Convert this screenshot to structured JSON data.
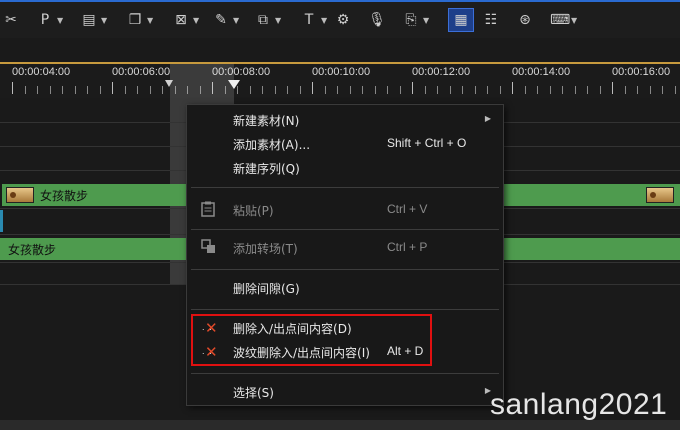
{
  "toolbar": {
    "items": [
      {
        "icon": "scissors-icon",
        "glyph": "✂",
        "caret": false
      },
      {
        "icon": "p-mode-icon",
        "glyph": "P",
        "caret": true
      },
      {
        "icon": "clipboard-icon",
        "glyph": "▤",
        "caret": true
      },
      {
        "icon": "copy-icon",
        "glyph": "❐",
        "caret": true
      },
      {
        "icon": "delete-icon",
        "glyph": "⊠",
        "caret": true
      },
      {
        "icon": "text-marker-icon",
        "glyph": "✎",
        "caret": true
      },
      {
        "icon": "crop-icon",
        "glyph": "⧉",
        "caret": true
      },
      {
        "icon": "title-icon",
        "glyph": "T",
        "caret": true
      },
      {
        "icon": "capture-icon",
        "glyph": "⚙",
        "caret": false
      },
      {
        "icon": "microphone-icon",
        "glyph": "🎙",
        "caret": false
      },
      {
        "icon": "video-effect-icon",
        "glyph": "⎘",
        "caret": true
      },
      {
        "icon": "grid-icon",
        "glyph": "▦",
        "caret": false,
        "active": true
      },
      {
        "icon": "mixer-icon",
        "glyph": "☷",
        "caret": false
      },
      {
        "icon": "reel-icon",
        "glyph": "⊛",
        "caret": false
      },
      {
        "icon": "keyboard-icon",
        "glyph": "⌨",
        "caret": true
      }
    ]
  },
  "ruler": {
    "labels": [
      "00:00:04:00",
      "00:00:06:00",
      "00:00:08:00",
      "00:00:10:00",
      "00:00:12:00",
      "00:00:14:00",
      "00:00:16:00"
    ]
  },
  "tracks": {
    "clip_video_left": "女孩散步",
    "clip_audio": "女孩散步"
  },
  "context_menu": {
    "new_material": "新建素材(N)",
    "add_material": "添加素材(A)...",
    "add_material_shortcut": "Shift + Ctrl + O",
    "new_sequence": "新建序列(Q)",
    "paste": "粘贴(P)",
    "paste_shortcut": "Ctrl + V",
    "add_transition": "添加转场(T)",
    "add_transition_shortcut": "Ctrl + P",
    "delete_gap": "删除间隙(G)",
    "delete_in_out": "删除入/出点间内容(D)",
    "ripple_delete_in_out": "波纹删除入/出点间内容(I)",
    "ripple_delete_shortcut": "Alt + D",
    "select": "选择(S)"
  },
  "watermark": "sanlang2021",
  "colors": {
    "clip_green": "#4e9b4e",
    "highlight_red": "#e01010",
    "timeline_accent": "#c79a3e",
    "active_tool_blue": "#1e3f8a"
  }
}
